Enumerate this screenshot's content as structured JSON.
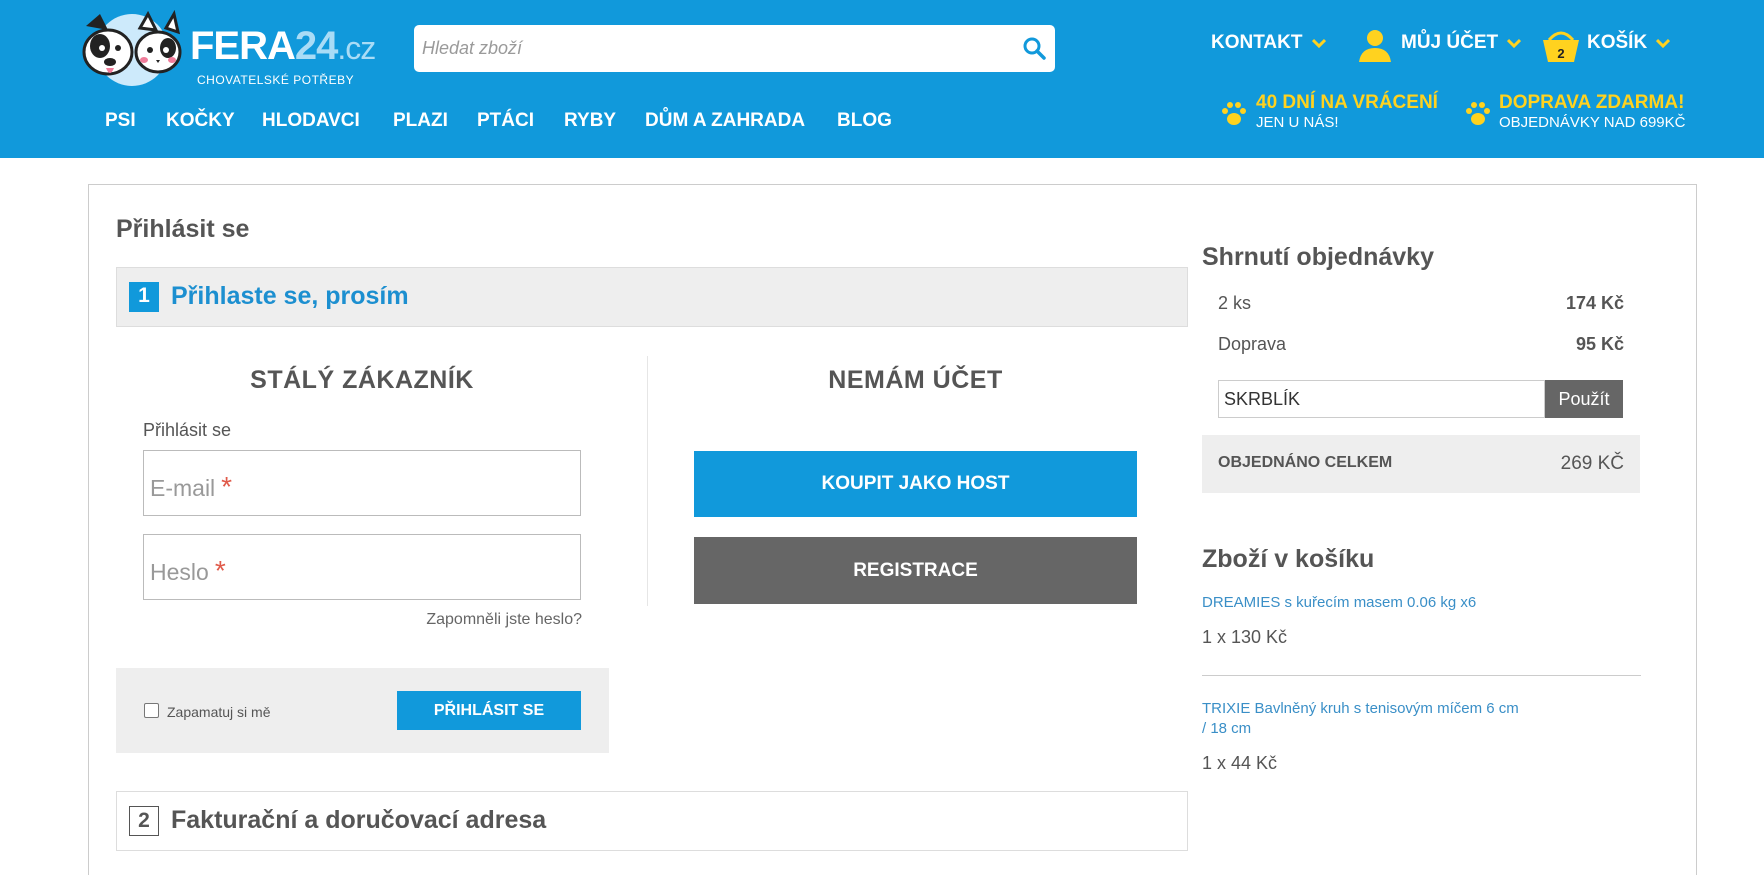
{
  "header": {
    "logo_name": "FERA",
    "logo_num": "24",
    "logo_tld": ".cz",
    "logo_sub": "CHOVATELSKÉ POTŘEBY",
    "search_placeholder": "Hledat zboží",
    "contact": "KONTAKT",
    "account": "MŮJ ÚČET",
    "cart": "KOŠÍK",
    "cart_count": "2",
    "nav": [
      "PSI",
      "KOČKY",
      "HLODAVCI",
      "PLAZI",
      "PTÁCI",
      "RYBY",
      "DŮM A ZAHRADA",
      "BLOG"
    ],
    "promo_return_title": "40 DNÍ NA VRÁCENÍ",
    "promo_return_sub": "JEN U NÁS!",
    "promo_shipping_title": "DOPRAVA ZDARMA!",
    "promo_shipping_sub": "OBJEDNÁVKY NAD 699KČ",
    "colors": {
      "brand_blue": "#1199db",
      "promo_yellow": "#ffd21f"
    }
  },
  "page": {
    "title": "Přihlásit se",
    "step1_num": "1",
    "step1_title": "Přihlaste se, prosím",
    "step2_num": "2",
    "step2_title": "Fakturační a doručovací adresa"
  },
  "login": {
    "title": "STÁLÝ ZÁKAZNÍK",
    "label": "Přihlásit se",
    "email_placeholder": "E-mail",
    "password_placeholder": "Heslo",
    "required_mark": "*",
    "forgot": "Zapomněli jste heslo?",
    "remember": "Zapamatuj si mě",
    "submit": "PŘIHLÁSIT SE"
  },
  "guest": {
    "title": "NEMÁM ÚČET",
    "guest_button": "KOUPIT JAKO HOST",
    "register_button": "REGISTRACE"
  },
  "summary": {
    "title": "Shrnutí objednávky",
    "items_label": "2 ks",
    "items_value": "174 Kč",
    "shipping_label": "Doprava",
    "shipping_value": "95 Kč",
    "coupon_value": "SKRBLÍK",
    "coupon_button": "Použít",
    "total_label": "OBJEDNÁNO CELKEM",
    "total_value": "269 KČ"
  },
  "cart": {
    "title": "Zboží v košíku",
    "items": [
      {
        "name": "DREAMIES s kuřecím masem 0.06 kg x6",
        "qty": "1 x 130 Kč"
      },
      {
        "name_line1": "TRIXIE Bavlněný kruh s tenisovým míčem 6 cm",
        "name_line2": "/ 18 cm",
        "qty": "1 x 44 Kč"
      }
    ]
  }
}
